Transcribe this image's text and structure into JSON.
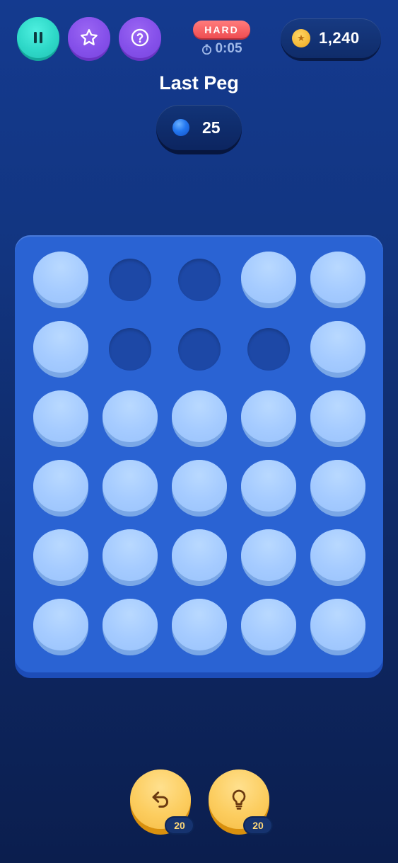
{
  "header": {
    "pause_icon": "pause-icon",
    "favorite_icon": "star-icon",
    "help_icon": "question-icon",
    "difficulty": "HARD",
    "timer": "0:05",
    "coins": "1,240"
  },
  "title": "Last Peg",
  "pegs_remaining": "25",
  "board": {
    "rows": 6,
    "cols": 5,
    "cells": [
      [
        1,
        0,
        0,
        1,
        1
      ],
      [
        1,
        0,
        0,
        0,
        1
      ],
      [
        1,
        1,
        1,
        1,
        1
      ],
      [
        1,
        1,
        1,
        1,
        1
      ],
      [
        1,
        1,
        1,
        1,
        1
      ],
      [
        1,
        1,
        1,
        1,
        1
      ]
    ]
  },
  "actions": {
    "undo_count": "20",
    "hint_count": "20"
  },
  "colors": {
    "background": "#123580",
    "board": "#2a63d3",
    "peg": "#a5cbff",
    "hole": "#1d48a6",
    "accent_teal": "#2ed8c8",
    "accent_purple": "#8550ea",
    "difficulty_red": "#ef4d52",
    "gold": "#fccd5f"
  }
}
